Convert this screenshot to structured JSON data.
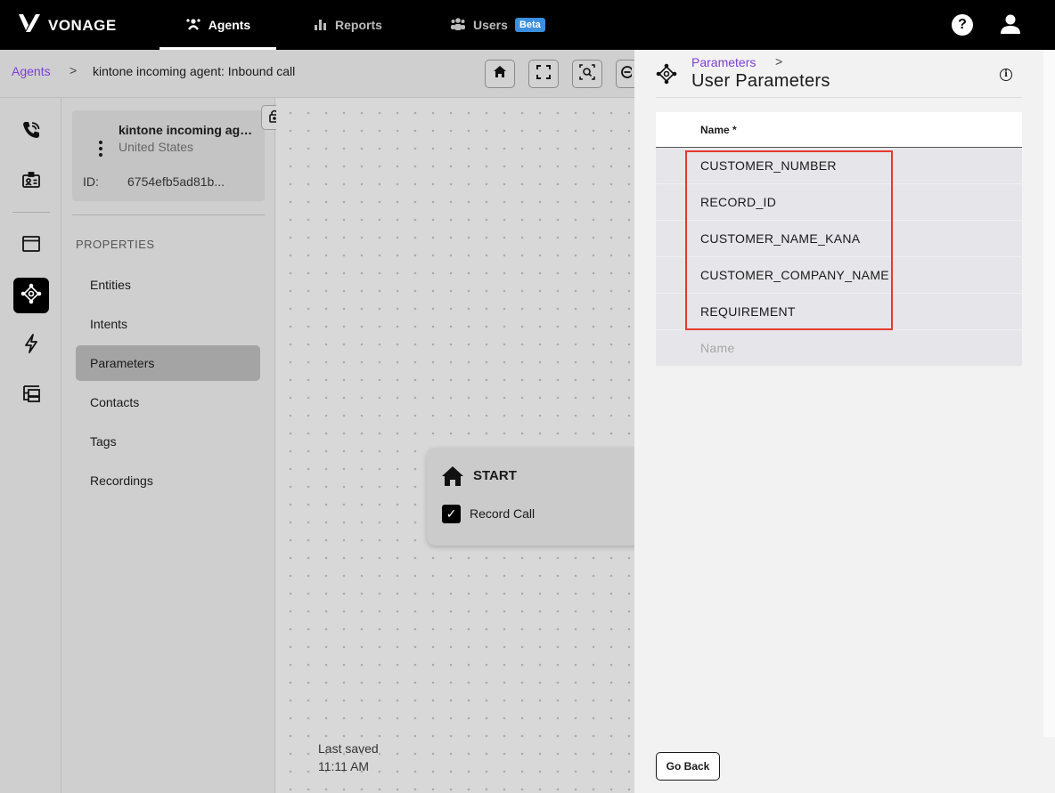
{
  "header": {
    "brand": "VONAGE",
    "nav": [
      {
        "label": "Agents",
        "icon": "agents-icon",
        "active": true
      },
      {
        "label": "Reports",
        "icon": "bar-chart-icon",
        "active": false
      },
      {
        "label": "Users",
        "icon": "users-icon",
        "active": false,
        "badge": "Beta"
      }
    ],
    "help_icon": "?",
    "colors": {
      "background": "#000000",
      "beta_badge": "#3b8fe0"
    }
  },
  "breadcrumb": {
    "root": "Agents",
    "separator": ">",
    "current": "kintone incoming agent: Inbound call"
  },
  "toolbar": {
    "buttons": [
      "home-icon",
      "fullscreen-icon",
      "zoom-fit-icon",
      "zoom-out-icon"
    ]
  },
  "rail": {
    "items": [
      "phone-icon",
      "id-card-icon",
      "window-icon",
      "diamond-nodes-icon",
      "lightning-icon",
      "tree-icon"
    ],
    "active": "diamond-nodes-icon"
  },
  "agent": {
    "name": "kintone incoming agent",
    "country": "United States",
    "id_label": "ID:",
    "id_value": "6754efb5ad81b..."
  },
  "properties": {
    "heading": "PROPERTIES",
    "items": [
      "Entities",
      "Intents",
      "Parameters",
      "Contacts",
      "Tags",
      "Recordings"
    ],
    "active": "Parameters"
  },
  "canvas": {
    "start_node": {
      "title": "START",
      "checkbox_label": "Record Call",
      "checked": true
    },
    "last_saved_label": "Last saved",
    "last_saved_time": "11:11 AM"
  },
  "panel": {
    "crumb": "Parameters",
    "crumb_separator": ">",
    "title": "User Parameters",
    "info_icon": "i",
    "column_header": "Name *",
    "rows": [
      "CUSTOMER_NUMBER",
      "RECORD_ID",
      "CUSTOMER_NAME_KANA",
      "CUSTOMER_COMPANY_NAME",
      "REQUIREMENT"
    ],
    "new_row_placeholder": "Name",
    "go_back": "Go Back",
    "colors": {
      "link": "#7b3fd4",
      "highlight": "#e53b2e",
      "row": "#e6e5ea"
    }
  }
}
